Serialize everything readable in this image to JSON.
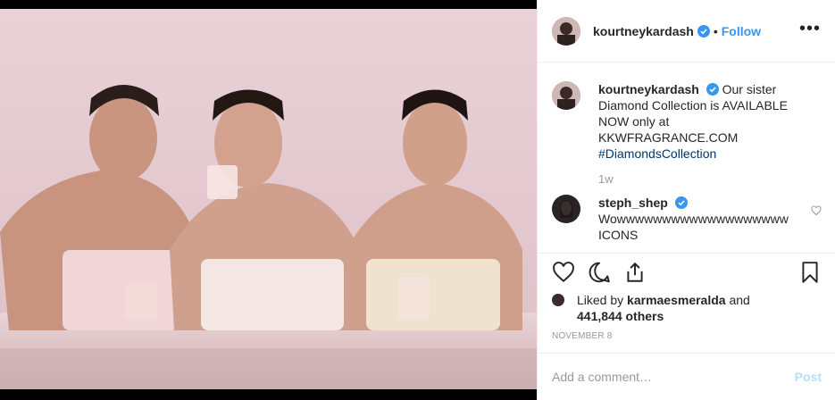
{
  "header": {
    "username": "kourtneykardash",
    "separator": "•",
    "follow_label": "Follow",
    "more_label": "•••"
  },
  "caption": {
    "username": "kourtneykardash",
    "text": "Our sister Diamond Collection is AVAILABLE NOW only at KKWFRAGRANCE.COM",
    "hashtag": "#DiamondsCollection",
    "time": "1w"
  },
  "comments": [
    {
      "username": "steph_shep",
      "text": "Wowwwwwwwwwwwwwwwwwww ICONS"
    }
  ],
  "likes": {
    "prefix": "Liked by",
    "user": "karmaesmeralda",
    "and": "and",
    "count": "441,844 others"
  },
  "date": "NOVEMBER 8",
  "add_comment": {
    "placeholder": "Add a comment…",
    "post_label": "Post"
  },
  "icons": {
    "like": "heart-icon",
    "comment": "comment-icon",
    "share": "share-icon",
    "save": "bookmark-icon",
    "verified": "verified-badge-icon"
  },
  "colors": {
    "link_blue": "#3897f0",
    "verified_blue": "#3897f0",
    "post_disabled": "#b2dffc",
    "muted": "#999999",
    "photo_backdrop": "#e7ccd3"
  }
}
